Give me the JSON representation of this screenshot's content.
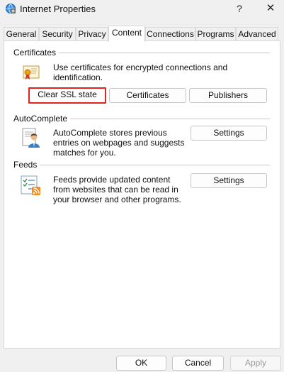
{
  "window": {
    "title": "Internet Properties",
    "help_glyph": "?",
    "close_glyph": "✕"
  },
  "tabs": [
    {
      "label": "General"
    },
    {
      "label": "Security"
    },
    {
      "label": "Privacy"
    },
    {
      "label": "Content"
    },
    {
      "label": "Connections"
    },
    {
      "label": "Programs"
    },
    {
      "label": "Advanced"
    }
  ],
  "active_tab": "Content",
  "certificates": {
    "group_title": "Certificates",
    "description": "Use certificates for encrypted connections and identification.",
    "buttons": {
      "clear_ssl": "Clear SSL state",
      "certificates": "Certificates",
      "publishers": "Publishers"
    }
  },
  "autocomplete": {
    "group_title": "AutoComplete",
    "description": "AutoComplete stores previous entries on webpages and suggests matches for you.",
    "settings": "Settings"
  },
  "feeds": {
    "group_title": "Feeds",
    "description": "Feeds provide updated content from websites that can be read in your browser and other programs.",
    "settings": "Settings"
  },
  "footer": {
    "ok": "OK",
    "cancel": "Cancel",
    "apply": "Apply"
  },
  "colors": {
    "highlight_border": "#e0261a",
    "panel_background": "#ffffff",
    "window_background": "#f0f0f0"
  }
}
